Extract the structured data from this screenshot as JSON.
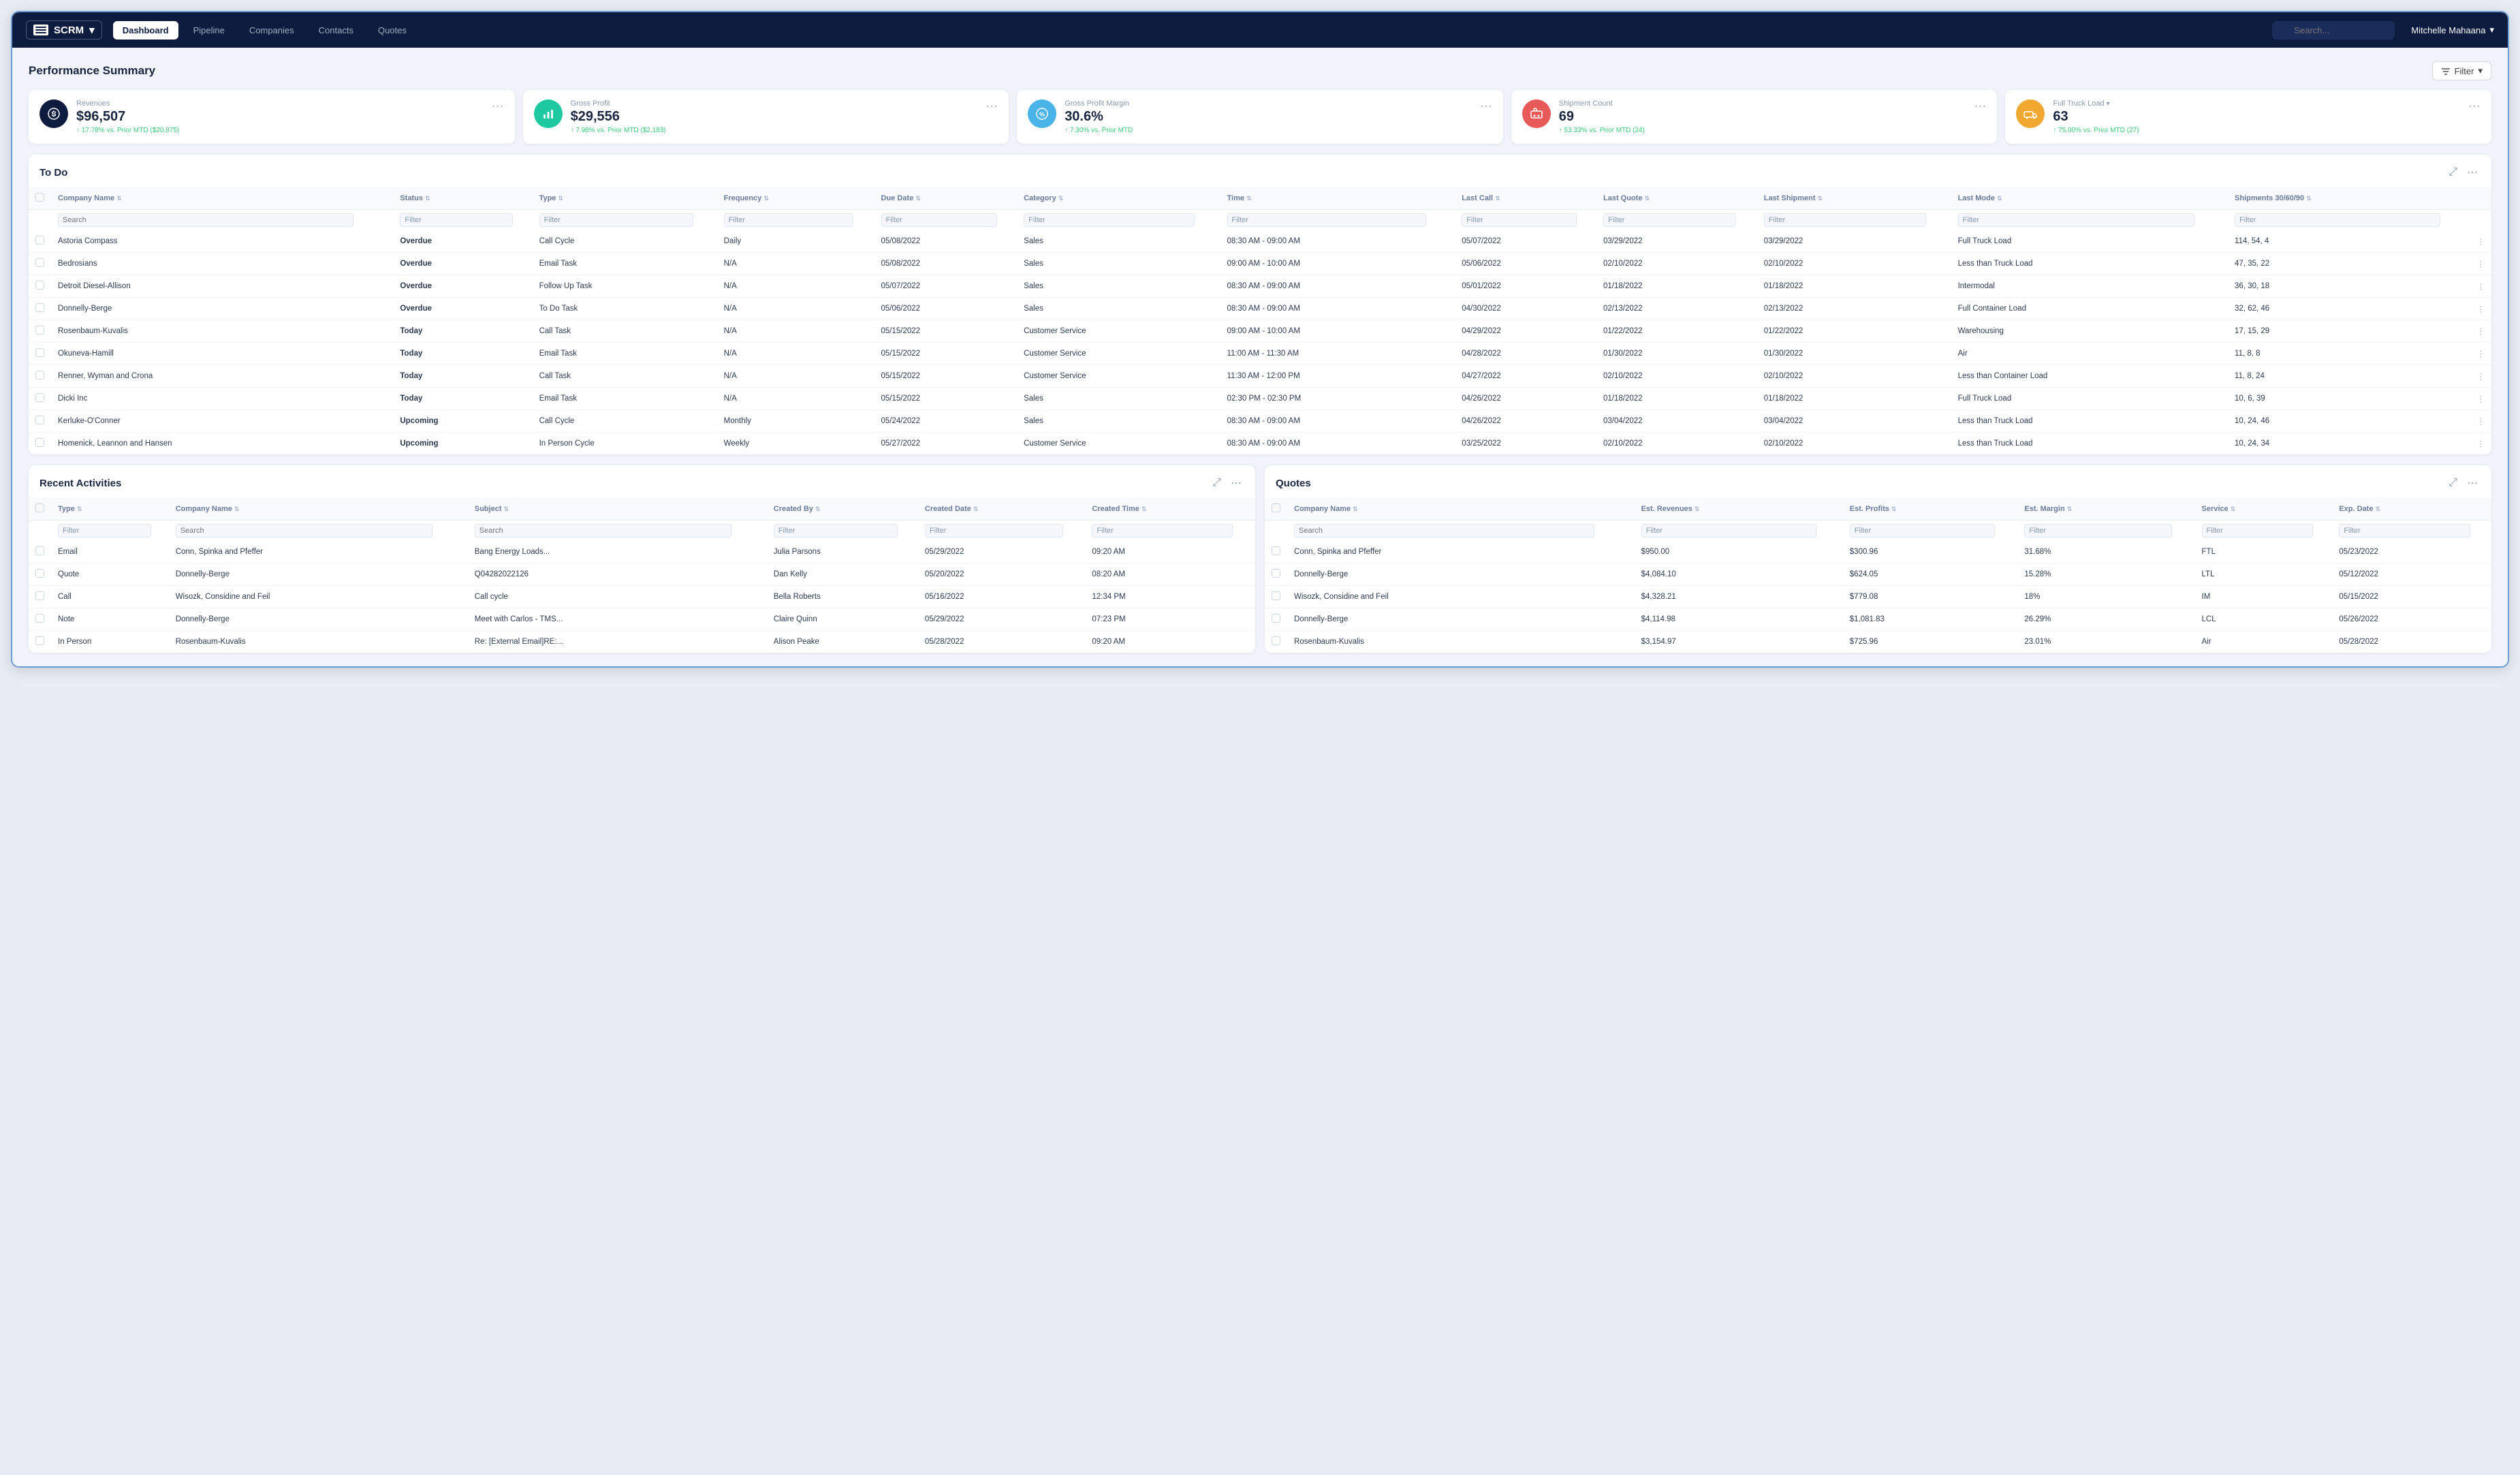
{
  "app": {
    "brand": "SCRM",
    "nav_tabs": [
      "Dashboard",
      "Pipeline",
      "Companies",
      "Contacts",
      "Quotes"
    ],
    "active_tab": "Dashboard",
    "search_placeholder": "Search...",
    "user": "Mitchelle Mahaana"
  },
  "perf_summary": {
    "title": "Performance Summary",
    "filter_label": "Filter",
    "kpis": [
      {
        "id": "revenues",
        "label": "Revenues",
        "value": "$96,507",
        "change": "↑ 17.78% vs. Prior MTD ($20,875)",
        "color": "navy"
      },
      {
        "id": "gross_profit",
        "label": "Gross Profit",
        "value": "$29,556",
        "change": "↑ 7.98% vs. Prior MTD ($2,183)",
        "color": "teal"
      },
      {
        "id": "gross_profit_margin",
        "label": "Gross Profit Margin",
        "value": "30.6%",
        "change": "↑ 7.30% vs. Prior MTD",
        "color": "teal2"
      },
      {
        "id": "shipment_count",
        "label": "Shipment Count",
        "value": "69",
        "change": "↑ 53.33% vs. Prior MTD (24)",
        "color": "red"
      },
      {
        "id": "full_truck_load",
        "label": "Full Truck Load",
        "value": "63",
        "change": "↑ 75.00% vs. Prior MTD (27)",
        "color": "gold"
      }
    ]
  },
  "todo": {
    "title": "To Do",
    "columns": [
      "Company Name",
      "Status",
      "Type",
      "Frequency",
      "Due Date",
      "Category",
      "Time",
      "Last Call",
      "Last Quote",
      "Last Shipment",
      "Last Mode",
      "Shipments 30/60/90"
    ],
    "filter_placeholders": [
      "Search",
      "Filter",
      "Filter",
      "Filter",
      "Filter",
      "Filter",
      "Filter",
      "Filter",
      "Filter",
      "Filter",
      "Filter",
      "Filter"
    ],
    "rows": [
      [
        "Astoria Compass",
        "Overdue",
        "Call Cycle",
        "Daily",
        "05/08/2022",
        "Sales",
        "08:30 AM - 09:00 AM",
        "05/07/2022",
        "03/29/2022",
        "03/29/2022",
        "Full Truck Load",
        "114, 54, 4"
      ],
      [
        "Bedrosians",
        "Overdue",
        "Email Task",
        "N/A",
        "05/08/2022",
        "Sales",
        "09:00 AM - 10:00 AM",
        "05/06/2022",
        "02/10/2022",
        "02/10/2022",
        "Less than Truck Load",
        "47, 35, 22"
      ],
      [
        "Detroit Diesel-Allison",
        "Overdue",
        "Follow Up Task",
        "N/A",
        "05/07/2022",
        "Sales",
        "08:30 AM - 09:00 AM",
        "05/01/2022",
        "01/18/2022",
        "01/18/2022",
        "Intermodal",
        "36, 30, 18"
      ],
      [
        "Donnelly-Berge",
        "Overdue",
        "To Do Task",
        "N/A",
        "05/06/2022",
        "Sales",
        "08:30 AM - 09:00 AM",
        "04/30/2022",
        "02/13/2022",
        "02/13/2022",
        "Full Container Load",
        "32, 62, 46"
      ],
      [
        "Rosenbaum-Kuvalis",
        "Today",
        "Call Task",
        "N/A",
        "05/15/2022",
        "Customer Service",
        "09:00 AM - 10:00 AM",
        "04/29/2022",
        "01/22/2022",
        "01/22/2022",
        "Warehousing",
        "17, 15, 29"
      ],
      [
        "Okuneva-Hamill",
        "Today",
        "Email Task",
        "N/A",
        "05/15/2022",
        "Customer Service",
        "11:00 AM - 11:30 AM",
        "04/28/2022",
        "01/30/2022",
        "01/30/2022",
        "Air",
        "11, 8, 8"
      ],
      [
        "Renner, Wyman and Crona",
        "Today",
        "Call Task",
        "N/A",
        "05/15/2022",
        "Customer Service",
        "11:30 AM - 12:00 PM",
        "04/27/2022",
        "02/10/2022",
        "02/10/2022",
        "Less than Container Load",
        "11, 8, 24"
      ],
      [
        "Dicki Inc",
        "Today",
        "Email Task",
        "N/A",
        "05/15/2022",
        "Sales",
        "02:30 PM - 02:30 PM",
        "04/26/2022",
        "01/18/2022",
        "01/18/2022",
        "Full Truck Load",
        "10, 6, 39"
      ],
      [
        "Kerluke-O'Conner",
        "Upcoming",
        "Call Cycle",
        "Monthly",
        "05/24/2022",
        "Sales",
        "08:30 AM - 09:00 AM",
        "04/26/2022",
        "03/04/2022",
        "03/04/2022",
        "Less than Truck Load",
        "10, 24, 46"
      ],
      [
        "Homenick, Leannon and Hansen",
        "Upcoming",
        "In Person Cycle",
        "Weekly",
        "05/27/2022",
        "Customer Service",
        "08:30 AM - 09:00 AM",
        "03/25/2022",
        "02/10/2022",
        "02/10/2022",
        "Less than Truck Load",
        "10, 24, 34"
      ]
    ]
  },
  "recent_activities": {
    "title": "Recent Activities",
    "columns": [
      "Type",
      "Company Name",
      "Subject",
      "Created By",
      "Created Date",
      "Created Time"
    ],
    "filter_placeholders": [
      "Filter",
      "Search",
      "Search",
      "Filter",
      "Filter",
      "Filter"
    ],
    "rows": [
      [
        "Email",
        "Conn, Spinka and Pfeffer",
        "Bang Energy Loads...",
        "Julia Parsons",
        "05/29/2022",
        "09:20 AM"
      ],
      [
        "Quote",
        "Donnelly-Berge",
        "Q04282022126",
        "Dan Kelly",
        "05/20/2022",
        "08:20 AM"
      ],
      [
        "Call",
        "Wisozk, Considine and Feil",
        "Call cycle",
        "Bella Roberts",
        "05/16/2022",
        "12:34 PM"
      ],
      [
        "Note",
        "Donnelly-Berge",
        "Meet with Carlos - TMS...",
        "Claire Quinn",
        "05/29/2022",
        "07:23 PM"
      ],
      [
        "In Person",
        "Rosenbaum-Kuvalis",
        "Re: [External Email]RE:...",
        "Alison Peake",
        "05/28/2022",
        "09:20 AM"
      ]
    ]
  },
  "quotes": {
    "title": "Quotes",
    "columns": [
      "Company Name",
      "Est. Revenues",
      "Est. Profits",
      "Est. Margin",
      "Service",
      "Exp. Date"
    ],
    "filter_placeholders": [
      "Search",
      "Filter",
      "Filter",
      "Filter",
      "Filter",
      "Filter"
    ],
    "rows": [
      [
        "Conn, Spinka and Pfeffer",
        "$950.00",
        "$300.96",
        "31.68%",
        "FTL",
        "05/23/2022"
      ],
      [
        "Donnelly-Berge",
        "$4,084.10",
        "$624.05",
        "15.28%",
        "LTL",
        "05/12/2022"
      ],
      [
        "Wisozk, Considine and Feil",
        "$4,328.21",
        "$779.08",
        "18%",
        "IM",
        "05/15/2022"
      ],
      [
        "Donnelly-Berge",
        "$4,114.98",
        "$1,081.83",
        "26.29%",
        "LCL",
        "05/26/2022"
      ],
      [
        "Rosenbaum-Kuvalis",
        "$3,154.97",
        "$725.96",
        "23.01%",
        "Air",
        "05/28/2022"
      ]
    ]
  }
}
